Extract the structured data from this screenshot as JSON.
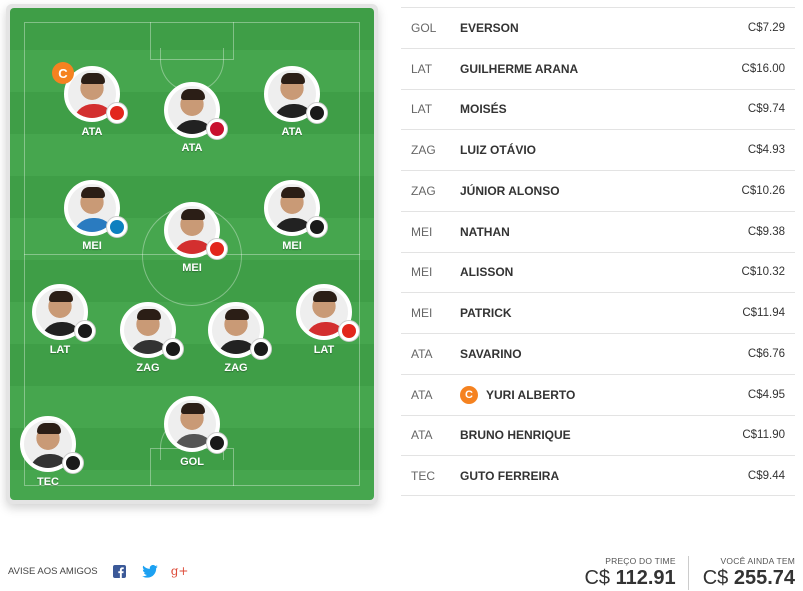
{
  "formation": {
    "players": [
      {
        "pos": "ATA",
        "captain": true,
        "captain_label": "C",
        "crest_color": "#e2261c",
        "shirt": "#d32f2f"
      },
      {
        "pos": "ATA",
        "captain": false,
        "crest_color": "#c8102e",
        "shirt": "#222222"
      },
      {
        "pos": "ATA",
        "captain": false,
        "crest_color": "#1a1a1a",
        "shirt": "#222222"
      },
      {
        "pos": "MEI",
        "captain": false,
        "crest_color": "#0d80bf",
        "shirt": "#2a7bc0"
      },
      {
        "pos": "MEI",
        "captain": false,
        "crest_color": "#e2261c",
        "shirt": "#d32f2f"
      },
      {
        "pos": "MEI",
        "captain": false,
        "crest_color": "#1a1a1a",
        "shirt": "#222222"
      },
      {
        "pos": "LAT",
        "captain": false,
        "crest_color": "#1a1a1a",
        "shirt": "#222222"
      },
      {
        "pos": "ZAG",
        "captain": false,
        "crest_color": "#1a1a1a",
        "shirt": "#333333"
      },
      {
        "pos": "ZAG",
        "captain": false,
        "crest_color": "#1a1a1a",
        "shirt": "#222222"
      },
      {
        "pos": "LAT",
        "captain": false,
        "crest_color": "#e2261c",
        "shirt": "#d32f2f"
      },
      {
        "pos": "GOL",
        "captain": false,
        "crest_color": "#1a1a1a",
        "shirt": "#555555"
      },
      {
        "pos": "TEC",
        "captain": false,
        "crest_color": "#1a1a1a",
        "shirt": "#333333"
      }
    ]
  },
  "roster": [
    {
      "pos": "GOL",
      "name": "EVERSON",
      "price": "C$7.29",
      "captain": false
    },
    {
      "pos": "LAT",
      "name": "GUILHERME ARANA",
      "price": "C$16.00",
      "captain": false
    },
    {
      "pos": "LAT",
      "name": "MOISÉS",
      "price": "C$9.74",
      "captain": false
    },
    {
      "pos": "ZAG",
      "name": "LUIZ OTÁVIO",
      "price": "C$4.93",
      "captain": false
    },
    {
      "pos": "ZAG",
      "name": "JÚNIOR ALONSO",
      "price": "C$10.26",
      "captain": false
    },
    {
      "pos": "MEI",
      "name": "NATHAN",
      "price": "C$9.38",
      "captain": false
    },
    {
      "pos": "MEI",
      "name": "ALISSON",
      "price": "C$10.32",
      "captain": false
    },
    {
      "pos": "MEI",
      "name": "PATRICK",
      "price": "C$11.94",
      "captain": false
    },
    {
      "pos": "ATA",
      "name": "SAVARINO",
      "price": "C$6.76",
      "captain": false
    },
    {
      "pos": "ATA",
      "name": "YURI ALBERTO",
      "price": "C$4.95",
      "captain": true,
      "captain_label": "C"
    },
    {
      "pos": "ATA",
      "name": "BRUNO HENRIQUE",
      "price": "C$11.90",
      "captain": false
    },
    {
      "pos": "TEC",
      "name": "GUTO FERREIRA",
      "price": "C$9.44",
      "captain": false
    }
  ],
  "share": {
    "label": "AVISE AOS AMIGOS",
    "icons": [
      "facebook-icon",
      "twitter-icon",
      "google-plus-icon"
    ],
    "google_plus_glyph": "g+"
  },
  "totals": {
    "team_price_label": "PREÇO DO TIME",
    "team_price_currency": "C$",
    "team_price_value": "112.91",
    "remaining_label": "VOCÊ AINDA TEM",
    "remaining_currency": "C$",
    "remaining_value": "255.74"
  },
  "colors": {
    "captain": "#f58220",
    "pitch_light": "#46a64e",
    "pitch_dark": "#3f9e47",
    "facebook": "#3b5998",
    "twitter": "#1da1f2",
    "google_plus": "#dd4b39"
  }
}
